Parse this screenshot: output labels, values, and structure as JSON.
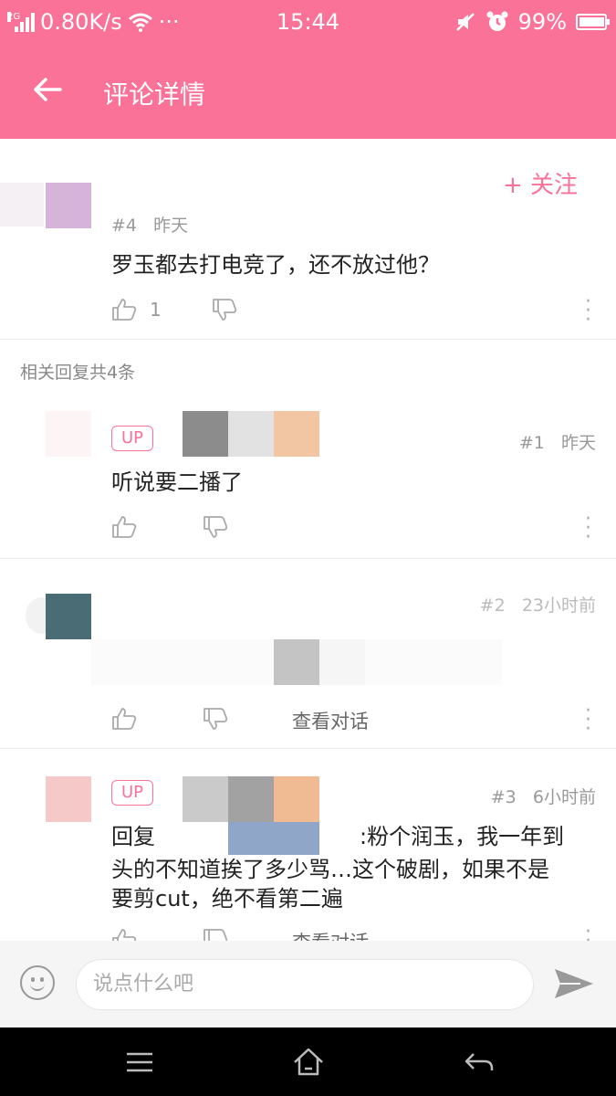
{
  "status_bar": {
    "network_type": "2G",
    "speed": "0.80K/s",
    "more": "···",
    "time": "15:44",
    "battery": "99%",
    "battery_level": 0.99
  },
  "app_bar": {
    "back_icon": "arrow-left-icon",
    "title": "评论详情"
  },
  "main_comment": {
    "follow_label": "+ 关注",
    "floor": "#4",
    "time": "昨天",
    "text": "罗玉都去打电竞了，还不放过他？",
    "like_count": "1"
  },
  "replies_header": "相关回复共4条",
  "replies": [
    {
      "badge": "UP",
      "floor": "#1",
      "time": "昨天",
      "text": "听说要二播了"
    },
    {
      "floor": "#2",
      "time": "23小时前",
      "dialog_label": "查看对话"
    },
    {
      "badge": "UP",
      "floor": "#3",
      "time": "6小时前",
      "text_prefix": "回复",
      "text_line1": ":粉个润玉，我一年到",
      "text_line2": "头的不知道挨了多少骂…这个破剧，如果不是",
      "text_line3": "要剪cut，绝不看第二遍",
      "dialog_label": "查看对话"
    }
  ],
  "input_bar": {
    "placeholder": "说点什么吧",
    "emoji_icon": "smiley-icon",
    "send_icon": "send-icon"
  },
  "colors": {
    "accent": "#fb7299",
    "text": "#222222",
    "muted": "#999999"
  }
}
